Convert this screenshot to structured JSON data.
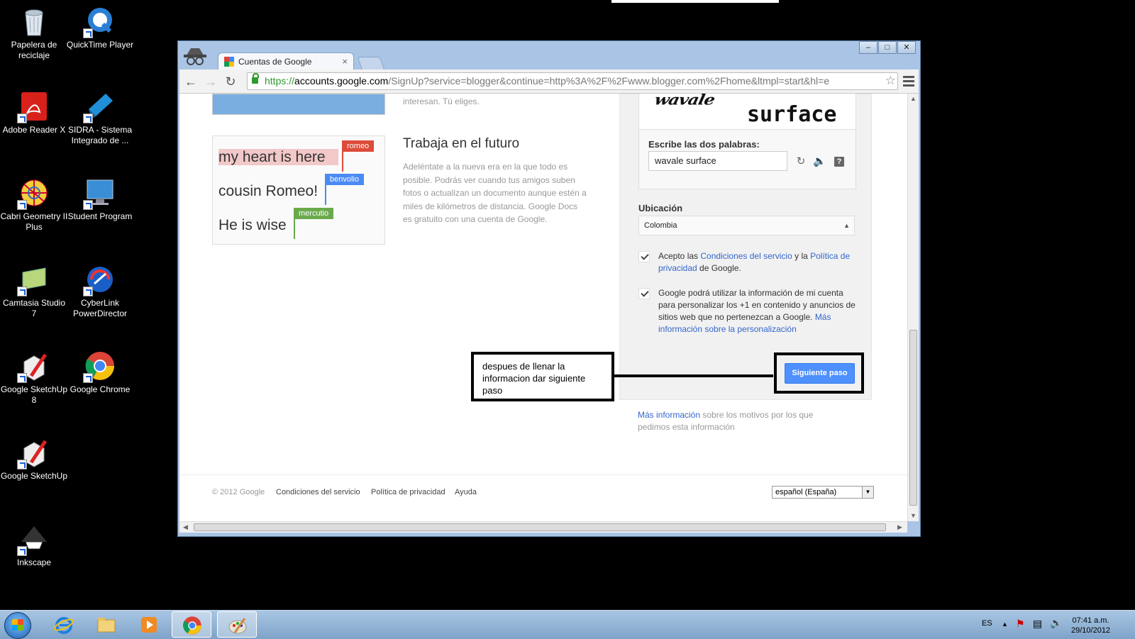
{
  "desktop": {
    "icons": [
      {
        "label": "Papelera de reciclaje"
      },
      {
        "label": "QuickTime Player"
      },
      {
        "label": "Adobe Reader X"
      },
      {
        "label": "SIDRA - Sistema Integrado de ..."
      },
      {
        "label": "Cabri Geometry II Plus"
      },
      {
        "label": "Student Program"
      },
      {
        "label": "Camtasia Studio 7"
      },
      {
        "label": "CyberLink PowerDirector"
      },
      {
        "label": "Google SketchUp 8"
      },
      {
        "label": "Google Chrome"
      },
      {
        "label": "Google SketchUp"
      },
      {
        "label": "Inkscape"
      }
    ]
  },
  "browser": {
    "tab_title": "Cuentas de Google",
    "tab_close": "×",
    "url_scheme": "https://",
    "url_host": "accounts.google.com",
    "url_path": "/SignUp?service=blogger&continue=http%3A%2F%2Fwww.blogger.com%2Fhome&ltmpl=start&hl=e",
    "window_controls": {
      "minimize": "–",
      "maximize": "□",
      "close": "✕"
    }
  },
  "page": {
    "promo_top_text": "interesan. Tú eliges.",
    "notes_demo": {
      "line1": "my heart is here",
      "line2": "cousin Romeo!",
      "line3": "He is wise",
      "tag1": "romeo",
      "tag2": "benvolio",
      "tag3": "mercutio"
    },
    "promo_title": "Trabaja en el futuro",
    "promo_body": "Adeléntate a la nueva era en la que todo es posible. Podrás ver cuando tus amigos suben fotos o actualizan un documento aunque estén a miles de kilómetros de distancia. Google Docs es gratuito con una cuenta de Google.",
    "captcha": {
      "word1": "wavale",
      "word2": "surface",
      "label": "Escribe las dos palabras:",
      "value": "wavale surface"
    },
    "location": {
      "label": "Ubicación",
      "value": "Colombia"
    },
    "terms": {
      "prefix": "Acepto las ",
      "link1": "Condiciones del servicio",
      "middle": " y la ",
      "link2": "Política de privacidad",
      "suffix": " de Google."
    },
    "personalization": {
      "text": "Google podrá utilizar la información de mi cuenta para personalizar los +1 en contenido y anuncios de sitios web que no pertenezcan a Google. ",
      "link": "Más información sobre la personalización"
    },
    "next_button": "Siguiente paso",
    "annotation": "despues de llenar la informacion dar siguiente paso",
    "more_info": {
      "link": "Más información",
      "text": " sobre los motivos por los que pedimos esta información"
    },
    "footer": {
      "copyright": "© 2012 Google",
      "terms": "Condiciones del servicio",
      "privacy": "Política de privacidad",
      "help": "Ayuda",
      "language": "español (España)"
    }
  },
  "taskbar": {
    "language": "ES",
    "time": "07:41 a.m.",
    "date": "29/10/2012"
  },
  "colors": {
    "accent_blue": "#4d90fe",
    "link_blue": "#3366cc",
    "tag_red": "#dd4b39",
    "tag_blue": "#4a8af4",
    "tag_green": "#6aaa4c"
  }
}
